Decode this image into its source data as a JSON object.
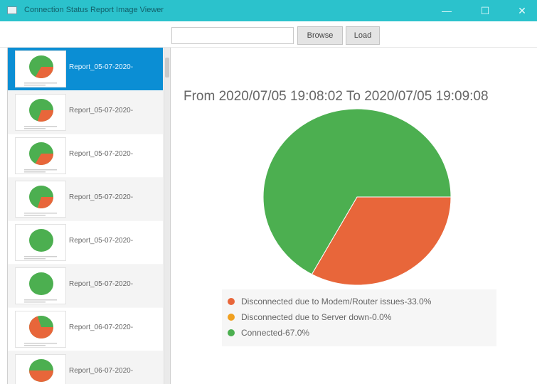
{
  "window": {
    "title": "Connection Status Report Image Viewer",
    "controls": {
      "minimize": "—",
      "maximize": "☐",
      "close": "✕"
    }
  },
  "toolbar": {
    "path_value": "",
    "path_placeholder": "",
    "browse_label": "Browse",
    "load_label": "Load"
  },
  "sidebar": {
    "items": [
      {
        "label": "Report_05-07-2020-",
        "selected": true,
        "disconnected_fraction": 0.33
      },
      {
        "label": "Report_05-07-2020-",
        "selected": false,
        "disconnected_fraction": 0.3
      },
      {
        "label": "Report_05-07-2020-",
        "selected": false,
        "disconnected_fraction": 0.33
      },
      {
        "label": "Report_05-07-2020-",
        "selected": false,
        "disconnected_fraction": 0.3
      },
      {
        "label": "Report_05-07-2020-",
        "selected": false,
        "disconnected_fraction": 0.0
      },
      {
        "label": "Report_05-07-2020-",
        "selected": false,
        "disconnected_fraction": 0.0
      },
      {
        "label": "Report_06-07-2020-",
        "selected": false,
        "disconnected_fraction": 0.7
      },
      {
        "label": "Report_06-07-2020-",
        "selected": false,
        "disconnected_fraction": 0.5
      }
    ]
  },
  "chart_data": {
    "type": "pie",
    "title": "From 2020/07/05 19:08:02 To 2020/07/05 19:09:08",
    "slices": [
      {
        "label": "Disconnected due to Modem/Router issues-33.0%",
        "value": 33.0,
        "color": "#e8663a"
      },
      {
        "label": "Disconnected due to Server down-0.0%",
        "value": 0.0,
        "color": "#f0a020"
      },
      {
        "label": "Connected-67.0%",
        "value": 67.0,
        "color": "#4caf50"
      }
    ],
    "legend_position": "bottom"
  },
  "colors": {
    "titlebar": "#2bc2cc",
    "selection": "#0b8ed4",
    "disconnected": "#e8663a",
    "connected": "#4caf50"
  }
}
